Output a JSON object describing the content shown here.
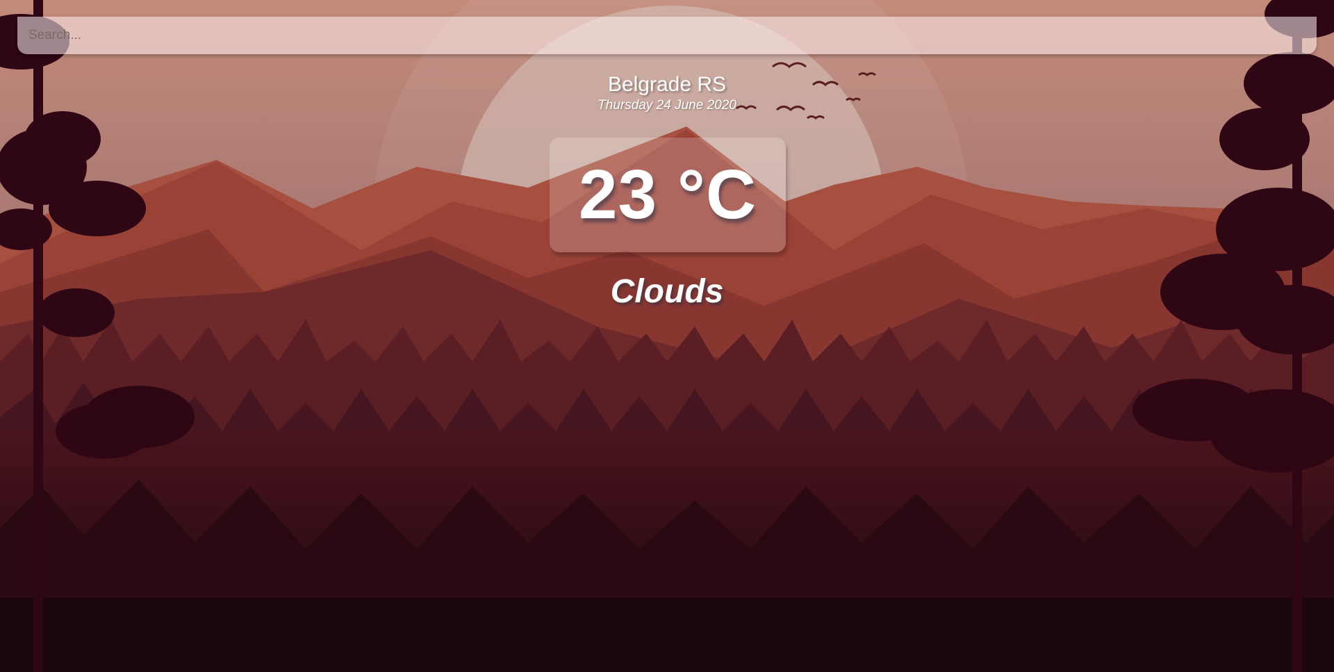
{
  "search": {
    "placeholder": "Search...",
    "value": ""
  },
  "location": {
    "city": "Belgrade RS",
    "date": "Thursday 24 June 2020"
  },
  "weather": {
    "temperature": "23 °C",
    "condition": "Clouds"
  },
  "background": {
    "scene": "sunset-mountain-forest",
    "colors": {
      "sky_top": "#c48a7a",
      "sky_bottom": "#9a6a66",
      "sun": "#d9c7c0",
      "mountains_far": "#a24a3c",
      "mountains_mid": "#8c3a30",
      "forest": "#3e1218",
      "foreground": "#1e0610"
    }
  }
}
